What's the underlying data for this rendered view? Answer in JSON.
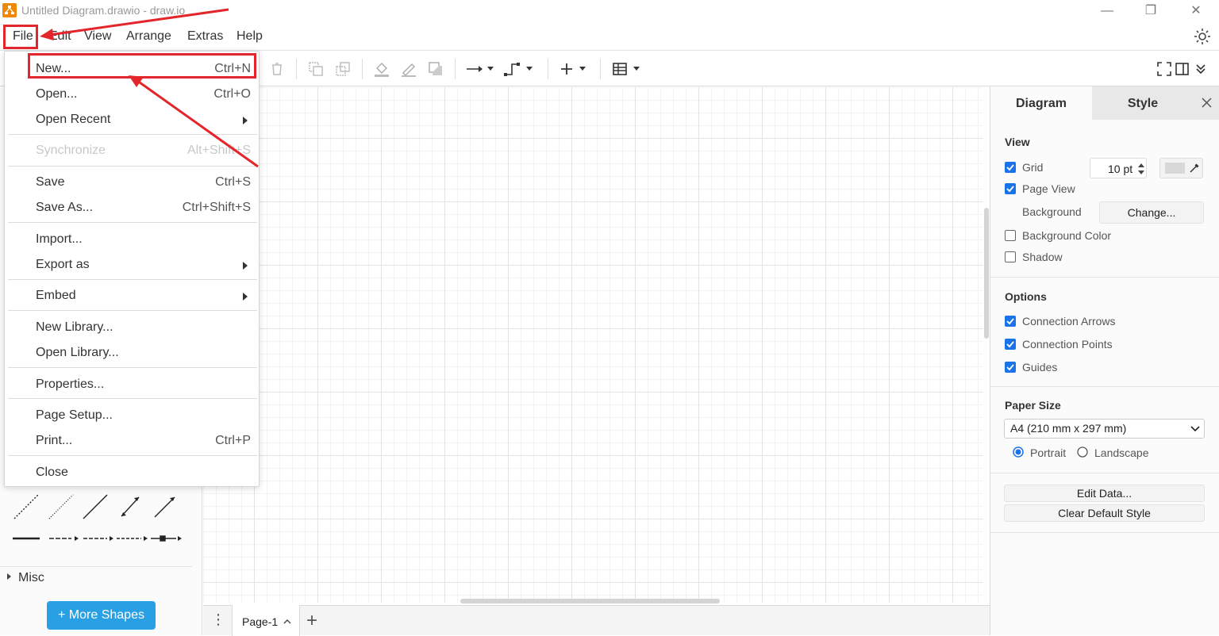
{
  "window": {
    "title": "Untitled Diagram.drawio - draw.io",
    "minimize_glyph": "—",
    "restore_glyph": "❐",
    "close_glyph": "✕"
  },
  "menubar": {
    "items": [
      "File",
      "Edit",
      "View",
      "Arrange",
      "Extras",
      "Help"
    ]
  },
  "file_menu": {
    "items": [
      {
        "label": "New...",
        "shortcut": "Ctrl+N",
        "enabled": true,
        "highlighted": true
      },
      {
        "label": "Open...",
        "shortcut": "Ctrl+O",
        "enabled": true
      },
      {
        "label": "Open Recent",
        "submenu": true,
        "enabled": true
      },
      {
        "label": "Synchronize",
        "shortcut": "Alt+Shift+S",
        "enabled": false
      },
      {
        "label": "Save",
        "shortcut": "Ctrl+S",
        "enabled": true
      },
      {
        "label": "Save As...",
        "shortcut": "Ctrl+Shift+S",
        "enabled": true
      },
      {
        "label": "Import...",
        "enabled": true
      },
      {
        "label": "Export as",
        "submenu": true,
        "enabled": true
      },
      {
        "label": "Embed",
        "submenu": true,
        "enabled": true
      },
      {
        "label": "New Library...",
        "enabled": true
      },
      {
        "label": "Open Library...",
        "enabled": true
      },
      {
        "label": "Properties...",
        "enabled": true
      },
      {
        "label": "Page Setup...",
        "enabled": true
      },
      {
        "label": "Print...",
        "shortcut": "Ctrl+P",
        "enabled": true
      },
      {
        "label": "Close",
        "enabled": true
      }
    ]
  },
  "left_panel": {
    "misc_label": "Misc",
    "more_shapes_label": "+ More Shapes"
  },
  "page_tabs": {
    "current": "Page-1",
    "menu_glyph": "⋮",
    "add_glyph": "+"
  },
  "right_panel": {
    "tabs": [
      "Diagram",
      "Style"
    ],
    "view": {
      "title": "View",
      "grid_label": "Grid",
      "grid_checked": true,
      "grid_size": "10 pt",
      "page_view_label": "Page View",
      "page_view_checked": true,
      "background_label": "Background",
      "change_label": "Change...",
      "background_color_label": "Background Color",
      "background_color_checked": false,
      "shadow_label": "Shadow",
      "shadow_checked": false
    },
    "options": {
      "title": "Options",
      "connection_arrows": "Connection Arrows",
      "connection_points": "Connection Points",
      "guides": "Guides"
    },
    "paper": {
      "title": "Paper Size",
      "selected": "A4 (210 mm x 297 mm)",
      "portrait": "Portrait",
      "landscape": "Landscape",
      "orientation": "Portrait"
    },
    "buttons": {
      "edit_data": "Edit Data...",
      "clear_default_style": "Clear Default Style"
    }
  },
  "colors": {
    "accent": "#1a73e8",
    "annotation_red": "#e3262b",
    "more_shapes_blue": "#29a0e4",
    "app_orange": "#f08705"
  }
}
